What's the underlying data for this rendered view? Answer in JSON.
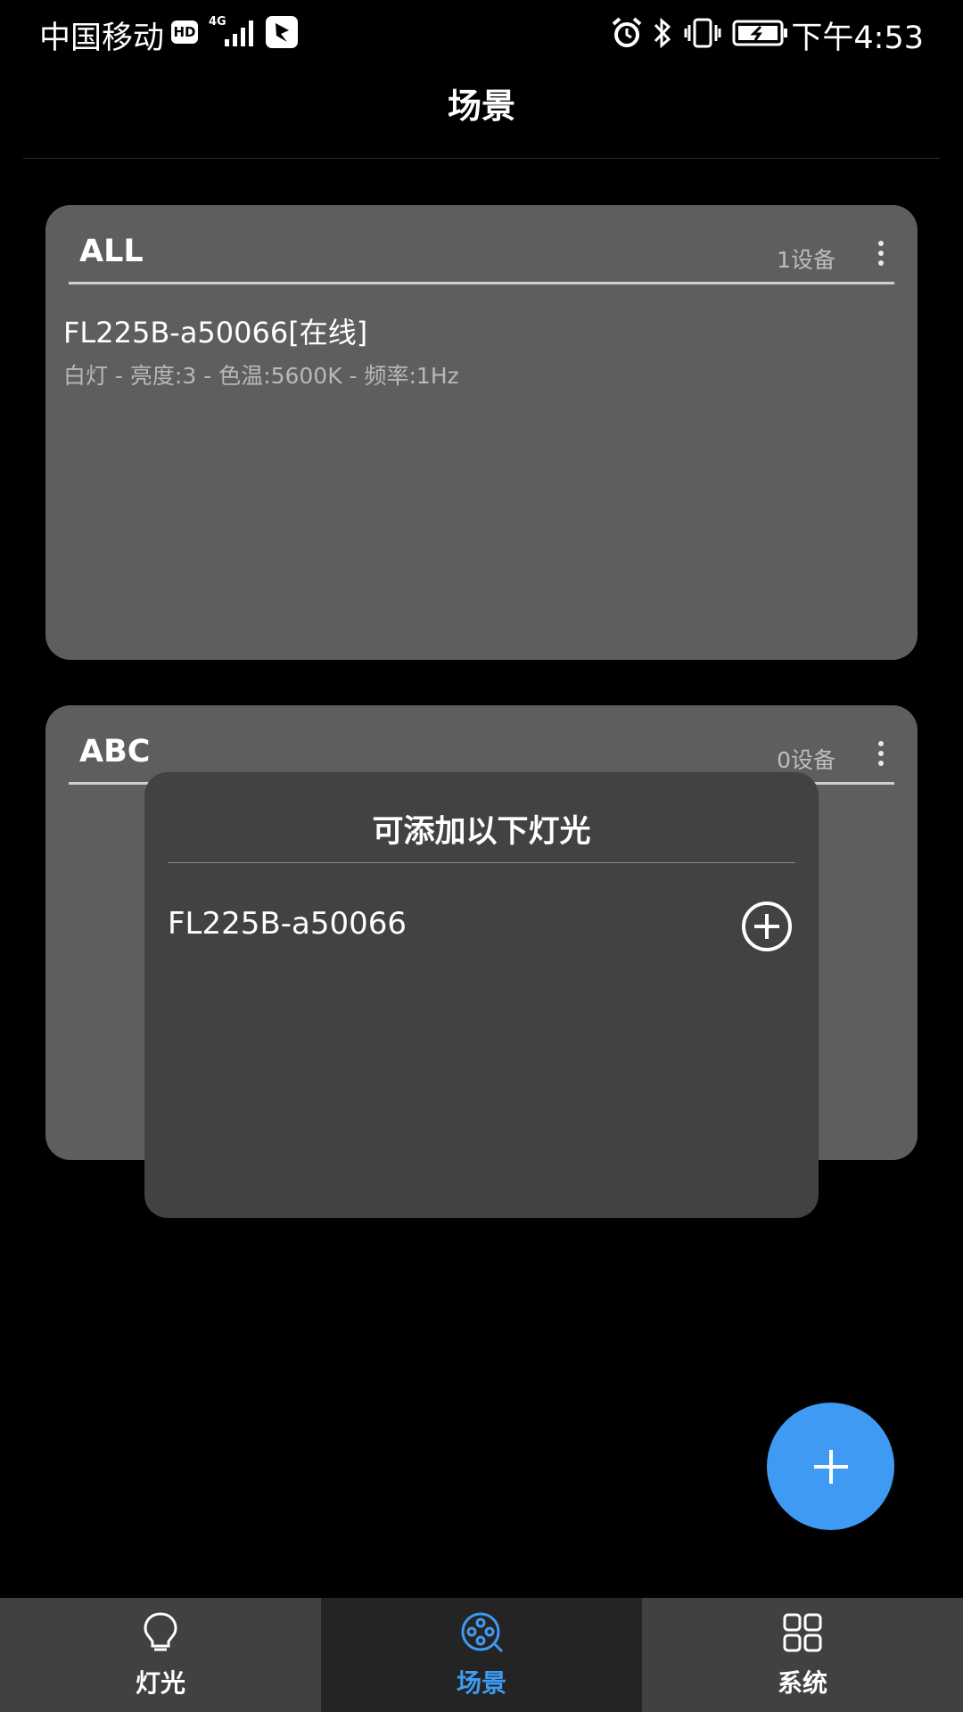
{
  "status_bar": {
    "carrier": "中国移动",
    "hd_badge": "HD",
    "network": "4G",
    "time": "下午4:53"
  },
  "header": {
    "title": "场景"
  },
  "scenes": [
    {
      "name": "ALL",
      "device_count": "1设备",
      "devices": [
        {
          "name": "FL225B-a50066[在线]",
          "info": "白灯 - 亮度:3 - 色温:5600K - 频率:1Hz"
        }
      ]
    },
    {
      "name": "ABC",
      "device_count": "0设备",
      "devices": []
    }
  ],
  "dialog": {
    "title": "可添加以下灯光",
    "items": [
      {
        "name": "FL225B-a50066"
      }
    ]
  },
  "bottom_nav": {
    "items": [
      {
        "label": "灯光",
        "icon": "bulb-icon",
        "active": false
      },
      {
        "label": "场景",
        "icon": "scene-reel-icon",
        "active": true
      },
      {
        "label": "系统",
        "icon": "grid-icon",
        "active": false
      }
    ]
  },
  "colors": {
    "accent": "#3e9af2",
    "card_bg": "#5e5e5e",
    "dialog_bg": "#424242",
    "nav_bg": "#414141",
    "nav_active_bg": "#242424"
  }
}
